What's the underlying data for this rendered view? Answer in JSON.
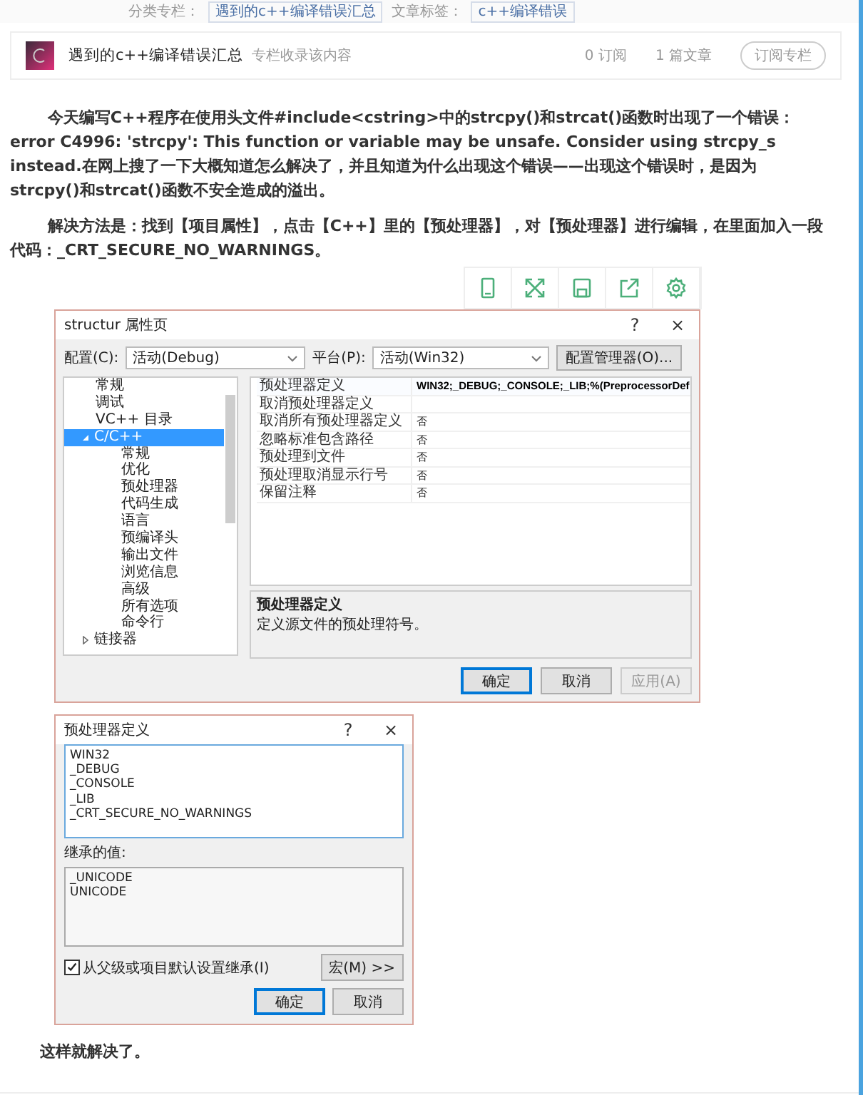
{
  "meta_strip": {
    "category_label": "分类专栏：",
    "category": "遇到的c++编译错误汇总",
    "tags_label": "文章标签：",
    "tag": "c++编译错误"
  },
  "column_card": {
    "title": "遇到的c++编译错误汇总",
    "subtitle": "专栏收录该内容",
    "subscribers": "0 订阅",
    "articles": "1 篇文章",
    "subscribe_button": "订阅专栏"
  },
  "paragraphs": [
    "今天编写C++程序在使用头文件#include<cstring>中的strcpy()和strcat()函数时出现了一个错误：error C4996: 'strcpy': This function or variable may be unsafe. Consider using strcpy_s instead.在网上搜了一下大概知道怎么解决了，并且知道为什么出现这个错误——出现这个错误时，是因为strcpy()和strcat()函数不安全造成的溢出。",
    "解决方法是：找到【项目属性】，点击【C++】里的【预处理器】，对【预处理器】进行编辑，在里面加入一段代码：_CRT_SECURE_NO_WARNINGS。"
  ],
  "dialog1": {
    "title": "structur 属性页",
    "help": "?",
    "close": "×",
    "config_label": "配置(C):",
    "config_value": "活动(Debug)",
    "platform_label": "平台(P):",
    "platform_value": "活动(Win32)",
    "config_manager": "配置管理器(O)...",
    "tree": [
      {
        "label": "常规",
        "selected": false
      },
      {
        "label": "调试",
        "selected": false
      },
      {
        "label": "VC++ 目录",
        "selected": false
      },
      {
        "label": "C/C++",
        "selected": true,
        "expanded": true,
        "children": [
          {
            "label": "常规",
            "selected": false
          },
          {
            "label": "优化",
            "selected": false
          },
          {
            "label": "预处理器",
            "selected": false
          },
          {
            "label": "代码生成",
            "selected": false
          },
          {
            "label": "语言",
            "selected": false
          },
          {
            "label": "预编译头",
            "selected": false
          },
          {
            "label": "输出文件",
            "selected": false
          },
          {
            "label": "浏览信息",
            "selected": false
          },
          {
            "label": "高级",
            "selected": false
          },
          {
            "label": "所有选项",
            "selected": false
          },
          {
            "label": "命令行",
            "selected": false
          }
        ]
      },
      {
        "label": "链接器",
        "selected": false,
        "expanded": false
      }
    ],
    "properties": [
      {
        "name": "预处理器定义",
        "value": "WIN32;_DEBUG;_CONSOLE;_LIB;%(PreprocessorDef",
        "bold": true
      },
      {
        "name": "取消预处理器定义"
      },
      {
        "name": "取消所有预处理器定义",
        "value": "否",
        "bold": false
      },
      {
        "name": "忽略标准包含路径",
        "value": "否",
        "bold": false
      },
      {
        "name": "预处理到文件",
        "value": "否",
        "bold": false
      },
      {
        "name": "预处理取消显示行号",
        "value": "否",
        "bold": false
      },
      {
        "name": "保留注释",
        "value": "否",
        "bold": false
      }
    ],
    "description": {
      "title": "预处理器定义",
      "text": "定义源文件的预处理符号。"
    },
    "buttons": [
      {
        "label": "确定",
        "disabled": false,
        "default": true
      },
      {
        "label": "取消",
        "disabled": false,
        "default": false
      },
      {
        "label": "应用(A)",
        "disabled": true,
        "default": false
      }
    ]
  },
  "dialog2": {
    "title": "预处理器定义",
    "help": "?",
    "close": "×",
    "definitions": [
      "WIN32",
      "_DEBUG",
      "_CONSOLE",
      "_LIB",
      "_CRT_SECURE_NO_WARNINGS"
    ],
    "inherited_label": "继承的值:",
    "inherited": [
      "_UNICODE",
      "UNICODE"
    ],
    "inherit_checkbox": {
      "label": "从父级或项目默认设置继承(I)",
      "checked": true
    },
    "macros_button": "宏(M) >>",
    "buttons": [
      {
        "label": "确定",
        "default": true
      },
      {
        "label": "取消",
        "default": false
      }
    ]
  },
  "closing": "这样就解决了。"
}
